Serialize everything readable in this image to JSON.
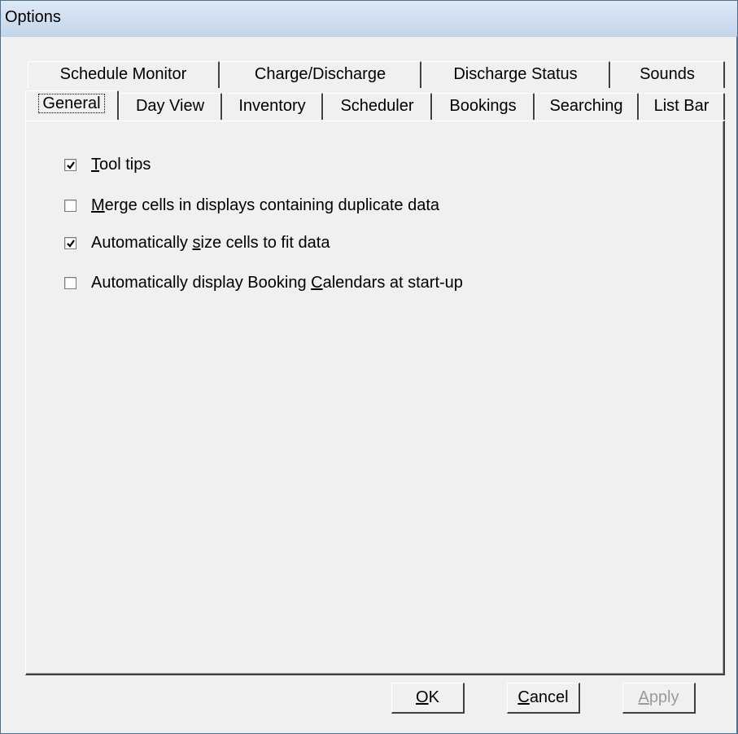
{
  "window": {
    "title": "Options"
  },
  "tabs": {
    "row1": [
      {
        "label": "Schedule Monitor"
      },
      {
        "label": "Charge/Discharge"
      },
      {
        "label": "Discharge Status"
      },
      {
        "label": "Sounds"
      }
    ],
    "row2": [
      {
        "label": "General",
        "active": true
      },
      {
        "label": "Day View"
      },
      {
        "label": "Inventory"
      },
      {
        "label": "Scheduler"
      },
      {
        "label": "Bookings"
      },
      {
        "label": "Searching"
      },
      {
        "label": "List Bar"
      }
    ]
  },
  "general": {
    "options": [
      {
        "pre": "",
        "accel": "T",
        "post": "ool tips",
        "checked": true
      },
      {
        "pre": "",
        "accel": "M",
        "post": "erge cells in displays containing duplicate data",
        "checked": false
      },
      {
        "pre": "Automatically ",
        "accel": "s",
        "post": "ize cells to fit data",
        "checked": true
      },
      {
        "pre": "Automatically display Booking ",
        "accel": "C",
        "post": "alendars at start-up",
        "checked": false
      }
    ]
  },
  "buttons": {
    "ok": {
      "accel": "O",
      "rest": "K"
    },
    "cancel": {
      "accel": "C",
      "rest": "ancel"
    },
    "apply": {
      "accel": "A",
      "rest": "pply",
      "disabled": true
    }
  }
}
